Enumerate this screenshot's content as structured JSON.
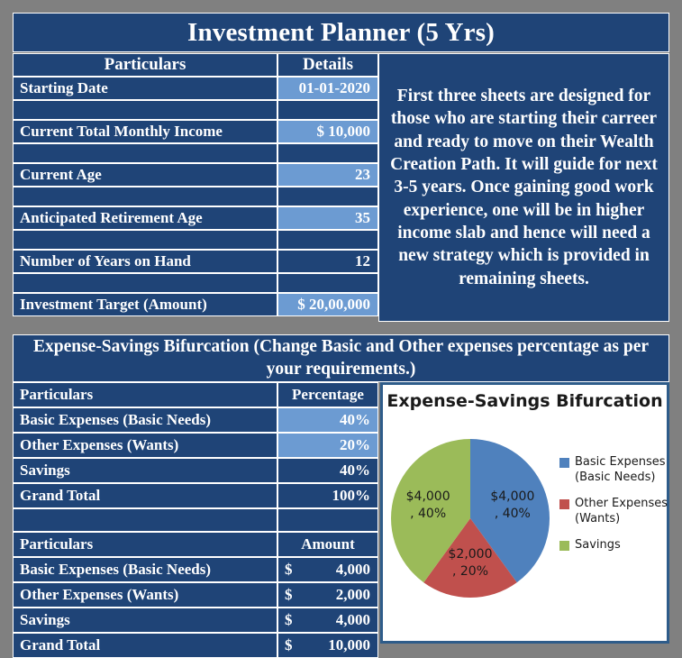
{
  "title": "Investment Planner (5 Yrs)",
  "colors": {
    "header_navy": "#1F4477",
    "highlight_blue": "#6C9BD2",
    "frame_gray": "#808080",
    "pie_blue": "#4F81BD",
    "pie_red": "#C0504D",
    "pie_green": "#9BBB59",
    "chart_border": "#2E5C8A"
  },
  "top_table": {
    "headers": [
      "Particulars",
      "Details"
    ],
    "rows": [
      {
        "label": "Starting Date",
        "value": "01-01-2020",
        "highlight": true,
        "align": "right"
      },
      {
        "label": "Current Total Monthly Income",
        "value": "$      10,000",
        "highlight": true,
        "align": "right"
      },
      {
        "label": "Current Age",
        "value": "23",
        "highlight": true,
        "align": "right"
      },
      {
        "label": "Anticipated Retirement Age",
        "value": "35",
        "highlight": true,
        "align": "right"
      },
      {
        "label": "Number of Years on Hand",
        "value": "12",
        "highlight": false,
        "align": "right"
      },
      {
        "label": "Investment Target (Amount)",
        "value": "$ 20,00,000",
        "highlight": true,
        "align": "right"
      }
    ]
  },
  "info_panel": {
    "text": "First three sheets are designed for those who are starting their carreer and ready to move on their Wealth Creation Path. It will guide for next 3-5 years. Once gaining good work experience, one will be in higher income slab and hence will need a new strategy which is provided in remaining sheets."
  },
  "banner": {
    "text": "Expense-Savings Bifurcation (Change Basic and Other expenses percentage as per your requirements.)"
  },
  "percentage_table": {
    "headers": [
      "Particulars",
      "Percentage"
    ],
    "rows": [
      {
        "label": "Basic Expenses (Basic Needs)",
        "value": "40%",
        "highlight": true
      },
      {
        "label": "Other Expenses (Wants)",
        "value": "20%",
        "highlight": true
      },
      {
        "label": "Savings",
        "value": "40%",
        "highlight": false
      },
      {
        "label": "Grand Total",
        "value": "100%",
        "highlight": false
      }
    ]
  },
  "amount_table": {
    "headers": [
      "Particulars",
      "Amount"
    ],
    "rows": [
      {
        "label": "Basic Expenses (Basic Needs)",
        "currency": "$",
        "value": "4,000"
      },
      {
        "label": "Other Expenses (Wants)",
        "currency": "$",
        "value": "2,000"
      },
      {
        "label": "Savings",
        "currency": "$",
        "value": "4,000"
      },
      {
        "label": "Grand Total",
        "currency": "$",
        "value": "10,000"
      }
    ]
  },
  "chart_data": {
    "type": "pie",
    "title": "Expense-Savings Bifurcation",
    "categories": [
      "Basic Expenses (Basic Needs)",
      "Other Expenses (Wants)",
      "Savings"
    ],
    "values": [
      4000,
      2000,
      4000
    ],
    "percentages": [
      40,
      20,
      40
    ],
    "colors": [
      "#4F81BD",
      "#C0504D",
      "#9BBB59"
    ],
    "data_labels": [
      "$4,000\n, 40%",
      "$2,000\n, 20%",
      "$4,000\n, 40%"
    ],
    "legend": [
      {
        "label": "Basic Expenses (Basic Needs)",
        "color": "#4F81BD"
      },
      {
        "label": "Other Expenses (Wants)",
        "color": "#C0504D"
      },
      {
        "label": "Savings",
        "color": "#9BBB59"
      }
    ],
    "legend_position": "right",
    "start_angle": 0,
    "grid": false
  }
}
